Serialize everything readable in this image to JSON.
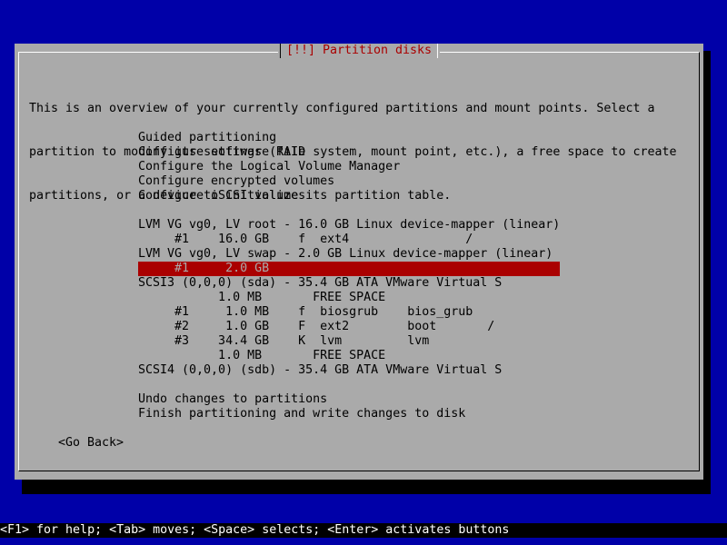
{
  "dialog": {
    "title": "[!!] Partition disks",
    "description": [
      "This is an overview of your currently configured partitions and mount points. Select a",
      "partition to modify its settings (file system, mount point, etc.), a free space to create",
      "partitions, or a device to initialize its partition table."
    ],
    "menu": [
      "Guided partitioning",
      "Configure software RAID",
      "Configure the Logical Volume Manager",
      "Configure encrypted volumes",
      "Configure iSCSI volumes",
      "",
      "LVM VG vg0, LV root - 16.0 GB Linux device-mapper (linear)",
      "     #1    16.0 GB    f  ext4                /",
      "LVM VG vg0, LV swap - 2.0 GB Linux device-mapper (linear)",
      "     #1     2.0 GB",
      "SCSI3 (0,0,0) (sda) - 35.4 GB ATA VMware Virtual S",
      "           1.0 MB       FREE SPACE",
      "     #1     1.0 MB    f  biosgrub    bios_grub",
      "     #2     1.0 GB    F  ext2        boot       /",
      "     #3    34.4 GB    K  lvm         lvm",
      "           1.0 MB       FREE SPACE",
      "SCSI4 (0,0,0) (sdb) - 35.4 GB ATA VMware Virtual S",
      "",
      "Undo changes to partitions",
      "Finish partitioning and write changes to disk"
    ],
    "selected_index": 9,
    "go_back": "<Go Back>"
  },
  "statusbar": {
    "text": "<F1> for help; <Tab> moves; <Space> selects; <Enter> activates buttons"
  }
}
